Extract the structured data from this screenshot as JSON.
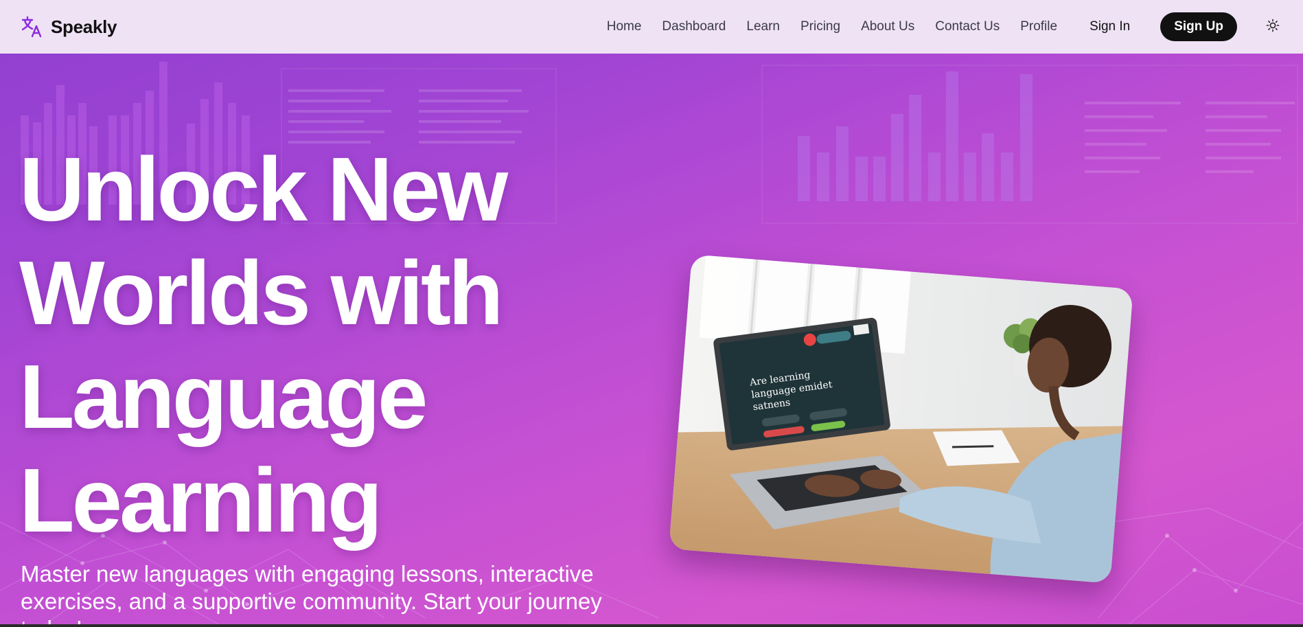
{
  "brand": {
    "name": "Speakly",
    "icon": "translate-icon"
  },
  "nav": {
    "links": [
      "Home",
      "Dashboard",
      "Learn",
      "Pricing",
      "About Us",
      "Contact Us",
      "Profile"
    ],
    "sign_in": "Sign In",
    "sign_up": "Sign Up",
    "theme_icon": "sun-icon"
  },
  "hero": {
    "title_lines": [
      "Unlock New",
      "Worlds with",
      "Language",
      "Learning"
    ],
    "subtitle": "Master new languages with engaging lessons, interactive exercises, and a supportive community. Start your journey today!",
    "image": {
      "description_icon": "person-using-laptop-image",
      "screen_text": "Are learning language emidet satnens"
    }
  },
  "colors": {
    "nav_bg": "#efe2f5",
    "gradient_start": "#8f3fd0",
    "gradient_end": "#d457cf",
    "signup_bg": "#111111",
    "brand_icon": "#8a2be2"
  }
}
